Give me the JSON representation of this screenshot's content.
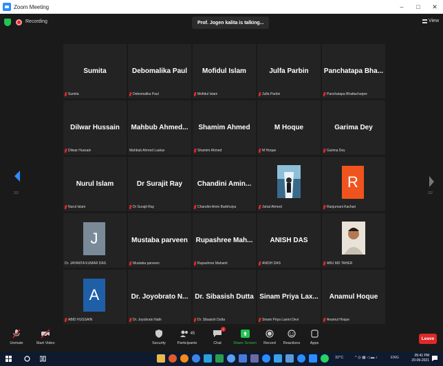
{
  "window": {
    "title": "Zoom Meeting",
    "controls": [
      "–",
      "□",
      "✕"
    ]
  },
  "topbar": {
    "recording_label": "Recording",
    "speaker": "Prof. Jogen kalita is talking...",
    "view_label": "View"
  },
  "page": {
    "left": "2/2",
    "right": "2/2"
  },
  "tiles": [
    {
      "name": "Sumita",
      "footer": "Sumita",
      "muted": true
    },
    {
      "name": "Debomalika Paul",
      "footer": "Debomalika Paul",
      "muted": true
    },
    {
      "name": "Mofidul Islam",
      "footer": "Mofidul Islam",
      "muted": true
    },
    {
      "name": "Julfa Parbin",
      "footer": "Julfa Parbin",
      "muted": true
    },
    {
      "name": "Panchatapa Bha...",
      "footer": "Panchatapa Bhattacharjee",
      "muted": true
    },
    {
      "name": "Dilwar Hussain",
      "footer": "Dilwar Hussain",
      "muted": true
    },
    {
      "name": "Mahbub  Ahmed...",
      "footer": "Mahbub Ahmed Laskar",
      "muted": false
    },
    {
      "name": "Shamim Ahmed",
      "footer": "Shamim Ahmed",
      "muted": true
    },
    {
      "name": "M Hoque",
      "footer": "M Hoque",
      "muted": true
    },
    {
      "name": "Garima Dey",
      "footer": "Garima Dey",
      "muted": true
    },
    {
      "name": "Nurul Islam",
      "footer": "Nurul Islam",
      "muted": true
    },
    {
      "name": "Dr Surajit Ray",
      "footer": "Dr Surajit Ray",
      "muted": true
    },
    {
      "name": "Chandini  Amin...",
      "footer": "Chandini Amin Barbhuiya",
      "muted": true
    },
    {
      "name": "",
      "footer": "Juhal Ahmed",
      "muted": true,
      "photo": "waterfall"
    },
    {
      "name": "",
      "footer": "Ranjumani Kachari",
      "muted": true,
      "avatar": "R",
      "avatar_color": "#f0541e"
    },
    {
      "name": "",
      "footer": "Dr. JAYANTA KUMAR DAS",
      "muted": false,
      "avatar": "J",
      "avatar_color": "#7a8a99"
    },
    {
      "name": "Mustaba parveen",
      "footer": "Mustaba parveen",
      "muted": true
    },
    {
      "name": "Rupashree  Mah...",
      "footer": "Rupashree Mahanti",
      "muted": true
    },
    {
      "name": "ANISH DAS",
      "footer": "ANISH DAS",
      "muted": true
    },
    {
      "name": "",
      "footer": "ABU MD TAHER",
      "muted": true,
      "photo": "person"
    },
    {
      "name": "",
      "footer": "ABID HUSSAIN",
      "muted": true,
      "avatar": "A",
      "avatar_color": "#1f5fa8"
    },
    {
      "name": "Dr. Joyobrato N...",
      "footer": "Dr. Joyobrato Nath",
      "muted": true
    },
    {
      "name": "Dr. Sibasish Dutta",
      "footer": "Dr. Sibasish Dutta",
      "muted": true
    },
    {
      "name": "Sinam Priya Lax...",
      "footer": "Sinam Priya Laxmi Devi",
      "muted": true
    },
    {
      "name": "Anamul Hoque",
      "footer": "Anamul Hoque",
      "muted": true
    }
  ],
  "toolbar": {
    "unmute": "Unmute",
    "start_video": "Start Video",
    "security": "Security",
    "participants": "Participants",
    "participants_count": "45",
    "chat": "Chat",
    "share_screen": "Share Screen",
    "record": "Record",
    "reactions": "Reactions",
    "apps": "Apps",
    "leave": "Leave",
    "chat_badge": "1"
  },
  "taskbar": {
    "temp": "32°C",
    "lang": "ENG",
    "time": "05:41 PM",
    "date": "20-09-2021"
  },
  "colors": {
    "accent": "#2d8cff",
    "danger": "#e02828",
    "share": "#23c552"
  }
}
